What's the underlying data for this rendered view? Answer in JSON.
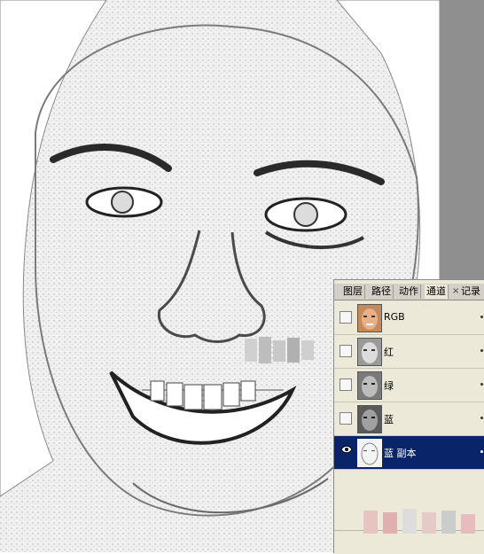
{
  "panel": {
    "tabs": [
      {
        "label": "图层"
      },
      {
        "label": "路径"
      },
      {
        "label": "动作"
      },
      {
        "label": "通道",
        "active": true
      },
      {
        "label": "记录"
      }
    ],
    "close_glyph": "×",
    "channels": [
      {
        "name": "RGB",
        "visible": false,
        "selected": false
      },
      {
        "name": "红",
        "visible": false,
        "selected": false
      },
      {
        "name": "绿",
        "visible": false,
        "selected": false
      },
      {
        "name": "蓝",
        "visible": false,
        "selected": false
      },
      {
        "name": "蓝 副本",
        "visible": true,
        "selected": true
      }
    ]
  },
  "colors": {
    "selection": "#0a246a",
    "panel_bg": "#ece9d8"
  },
  "icons": {
    "visibility": "eye-icon"
  }
}
